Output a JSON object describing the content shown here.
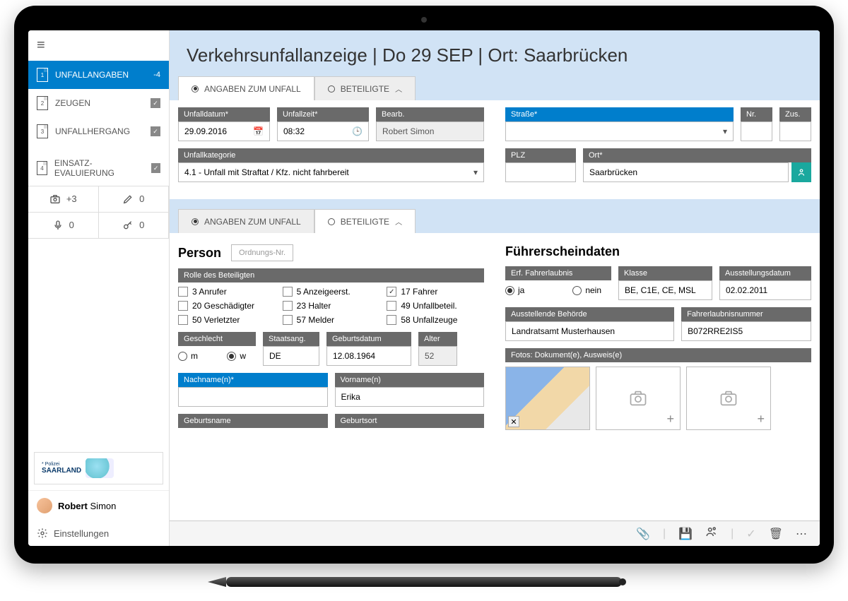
{
  "sidebar": {
    "items": [
      {
        "label": "UNFALLANGABEN",
        "badge": "-4"
      },
      {
        "label": "ZEUGEN"
      },
      {
        "label": "UNFALLHERGANG"
      },
      {
        "label": "EINSATZ-EVALUIERUNG"
      }
    ],
    "counters": {
      "camera": "+3",
      "pencil": "0",
      "mic": "0",
      "key": "0"
    },
    "logo_prefix": "* Polizei",
    "logo_text": "SAARLAND",
    "user_first": "Robert",
    "user_last": "Simon",
    "settings": "Einstellungen"
  },
  "header": {
    "title": "Verkehrsunfallanzeige | Do 29 SEP | Ort: Saarbrücken"
  },
  "tabs": {
    "t1": "ANGABEN ZUM UNFALL",
    "t2": "BETEILIGTE"
  },
  "unfall": {
    "datum_label": "Unfalldatum*",
    "datum": "29.09.2016",
    "zeit_label": "Unfallzeit*",
    "zeit": "08:32",
    "bearb_label": "Bearb.",
    "bearb": "Robert Simon",
    "strasse_label": "Straße*",
    "nr_label": "Nr.",
    "zus_label": "Zus.",
    "kat_label": "Unfallkategorie",
    "kat": "4.1 - Unfall mit Straftat / Kfz. nicht fahrbereit",
    "plz_label": "PLZ",
    "ort_label": "Ort*",
    "ort": "Saarbrücken"
  },
  "person": {
    "title": "Person",
    "ord_placeholder": "Ordnungs-Nr.",
    "rolle_label": "Rolle des Beteiligten",
    "roles": {
      "r3": "3 Anrufer",
      "r5": "5 Anzeigeerst.",
      "r17": "17 Fahrer",
      "r20": "20 Geschädigter",
      "r23": "23 Halter",
      "r49": "49 Unfallbeteil.",
      "r50": "50 Verletzter",
      "r57": "57 Melder",
      "r58": "58 Unfallzeuge"
    },
    "geschlecht_label": "Geschlecht",
    "m": "m",
    "w": "w",
    "staats_label": "Staatsang.",
    "staats": "DE",
    "geb_label": "Geburtsdatum",
    "geb": "12.08.1964",
    "alter_label": "Alter",
    "alter": "52",
    "nachname_label": "Nachname(n)*",
    "vorname_label": "Vorname(n)",
    "vorname": "Erika",
    "gebname_label": "Geburtsname",
    "gebort_label": "Geburtsort"
  },
  "fschein": {
    "title": "Führerscheindaten",
    "erl_label": "Erf. Fahrerlaubnis",
    "ja": "ja",
    "nein": "nein",
    "klasse_label": "Klasse",
    "klasse": "BE, C1E, CE, MSL",
    "ausdat_label": "Ausstellungsdatum",
    "ausdat": "02.02.2011",
    "beh_label": "Ausstellende Behörde",
    "beh": "Landratsamt Musterhausen",
    "nr_label": "Fahrerlaubnisnummer",
    "nr": "B072RRE2IS5",
    "fotos_label": "Fotos: Dokument(e), Ausweis(e)"
  }
}
